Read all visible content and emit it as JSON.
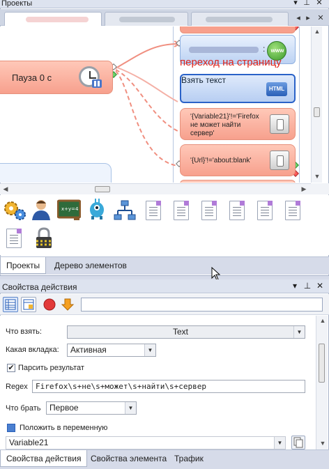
{
  "top_panel": {
    "title": "Проекты",
    "pin_icon": "pin-icon",
    "close_icon": "close-icon",
    "doc_tabs": [
      "",
      "",
      ""
    ],
    "nodes": {
      "pause": "Пауза 0 с",
      "link_text": "переход на страницу",
      "take_text": "Взять текст",
      "html_badge": "HTML",
      "www_badge": "www",
      "condition1": "'{Variable21}'!='Firefox не может найти сервер'",
      "condition2": "'{Url}'!='about:blank'"
    },
    "palette_icons": [
      "gears-icon",
      "user-icon",
      "chalkboard-icon",
      "robot-icon",
      "network-icon",
      "document-icon",
      "document-icon",
      "document-icon",
      "document-icon",
      "document-icon",
      "document-icon",
      "document-icon",
      "document-icon",
      "lock-icon"
    ],
    "bottom_tabs": [
      "Проекты",
      "Дерево элементов"
    ]
  },
  "props_panel": {
    "title": "Свойства действия",
    "fields": {
      "what_take_label": "Что взять:",
      "what_take_value": "Text",
      "tab_label": "Какая вкладка:",
      "tab_value": "Активная",
      "parse_label": "Парсить результат",
      "parse_checked": true,
      "regex_label": "Regex",
      "regex_value": "Firefox\\s+не\\s+может\\s+найти\\s+сервер",
      "take_label": "Что брать",
      "take_value": "Первое",
      "store_label": "Положить в переменную",
      "variable_value": "Variable21"
    },
    "bottom_tabs": [
      "Свойства действия",
      "Свойства элемента",
      "Трафик"
    ]
  },
  "colors": {
    "node_fill": "#f7a08d",
    "action_fill": "#bcd2f3",
    "link_red": "#e0241b",
    "panel_bg": "#d6dbe9"
  }
}
